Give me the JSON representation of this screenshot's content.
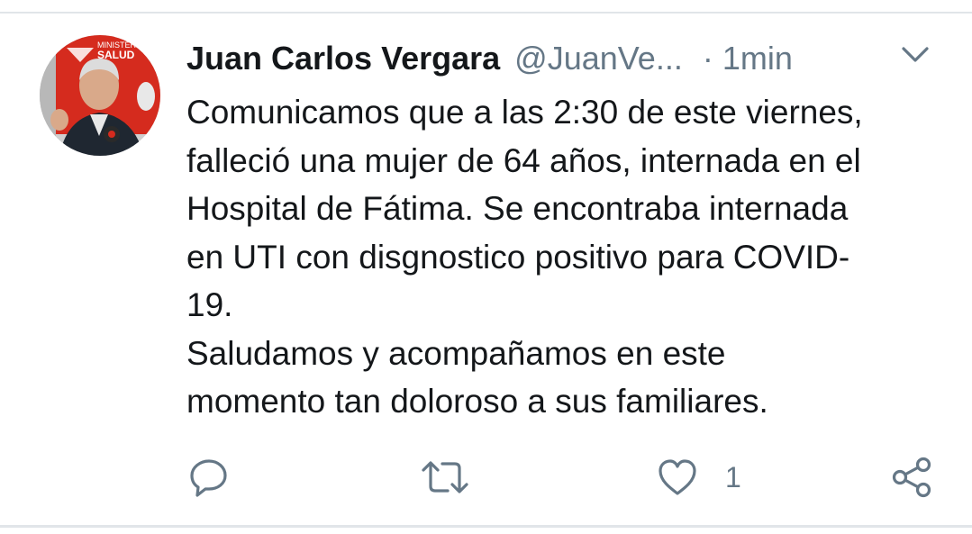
{
  "tweet": {
    "author_name": "Juan Carlos Vergara",
    "handle": "@JuanVe...",
    "separator": "·",
    "time": "1min",
    "avatar_text_top": "MINISTERIO",
    "avatar_text_bottom": "SALUD",
    "text_lines": [
      "Comunicamos que a las 2:30 de este viernes,",
      "falleció una mujer de 64 años, internada en el",
      "Hospital de Fátima. Se encontraba internada",
      "en UTI con disgnostico positivo para COVID-",
      "19.",
      "Saludamos y acompañamos en este",
      "momento tan doloroso a sus familiares."
    ]
  },
  "actions": {
    "reply_icon": "reply-icon",
    "retweet_icon": "retweet-icon",
    "like_icon": "heart-icon",
    "like_count": "1",
    "share_icon": "share-icon"
  },
  "colors": {
    "text": "#14171a",
    "secondary": "#657786",
    "icon": "#657786",
    "divider": "#e1e5e9",
    "brand_red": "#d52b1e"
  }
}
